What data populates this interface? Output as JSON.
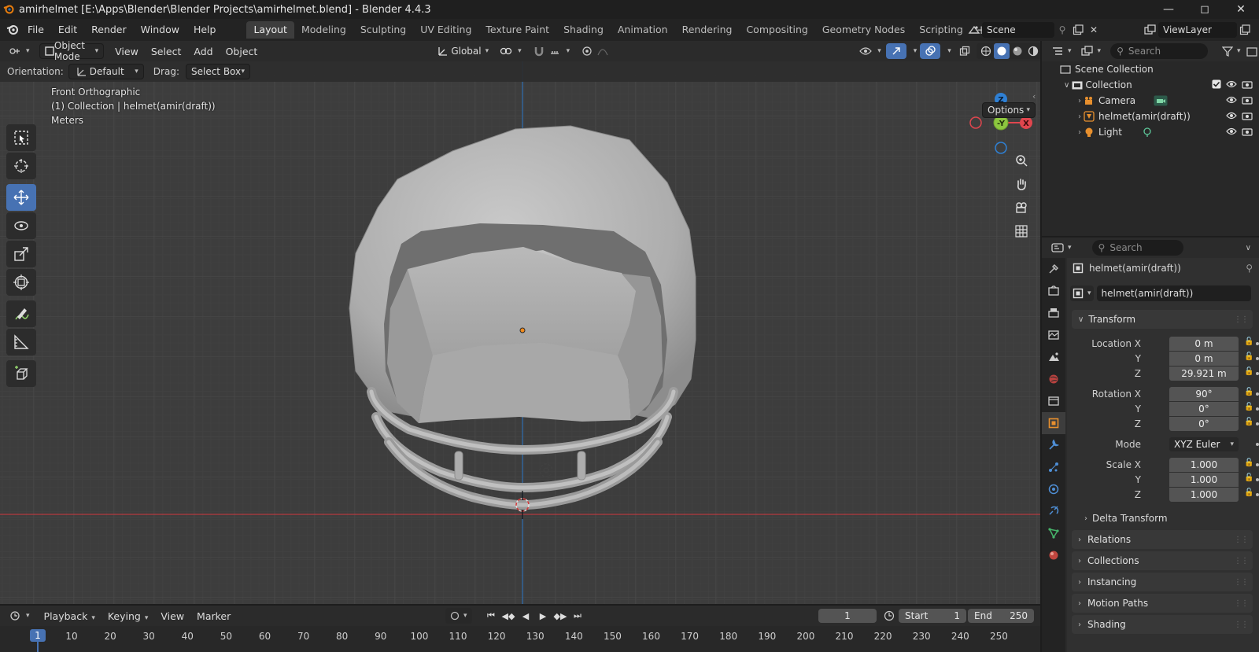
{
  "window": {
    "title": "amirhelmet [E:\\Apps\\Blender\\Blender Projects\\amirhelmet.blend] - Blender 4.4.3",
    "controls": [
      "minimize",
      "maximize",
      "close"
    ]
  },
  "menu": [
    "File",
    "Edit",
    "Render",
    "Window",
    "Help"
  ],
  "workspaces": [
    {
      "label": "Layout",
      "active": true
    },
    {
      "label": "Modeling"
    },
    {
      "label": "Sculpting"
    },
    {
      "label": "UV Editing"
    },
    {
      "label": "Texture Paint"
    },
    {
      "label": "Shading"
    },
    {
      "label": "Animation"
    },
    {
      "label": "Rendering"
    },
    {
      "label": "Compositing"
    },
    {
      "label": "Geometry Nodes"
    },
    {
      "label": "Scripting"
    }
  ],
  "scene": {
    "name": "Scene",
    "view_layer": "ViewLayer"
  },
  "viewport": {
    "mode": "Object Mode",
    "menus": [
      "View",
      "Select",
      "Add",
      "Object"
    ],
    "transform_orientation": "Global",
    "tool_settings": {
      "orientation_label": "Orientation:",
      "orientation_value": "Default",
      "drag_label": "Drag:",
      "drag_value": "Select Box"
    },
    "options_label": "Options",
    "overlay_text": {
      "view_name": "Front Orthographic",
      "collection_line": "(1) Collection | helmet(amir(draft))",
      "units": "Meters"
    },
    "gizmo_axes": {
      "z": "Z",
      "y": "-Y",
      "x": "X"
    }
  },
  "timeline": {
    "menus": [
      "Playback",
      "Keying",
      "View",
      "Marker"
    ],
    "current_frame": "1",
    "start_label": "Start",
    "start_value": "1",
    "end_label": "End",
    "end_value": "250",
    "ruler": [
      "1",
      "10",
      "20",
      "30",
      "40",
      "50",
      "60",
      "70",
      "80",
      "90",
      "100",
      "110",
      "120",
      "130",
      "140",
      "150",
      "160",
      "170",
      "180",
      "190",
      "200",
      "210",
      "220",
      "230",
      "240",
      "250"
    ]
  },
  "outliner": {
    "search_placeholder": "Search",
    "scene_collection": "Scene Collection",
    "collection": "Collection",
    "items": [
      {
        "name": "Camera",
        "type": "camera"
      },
      {
        "name": "helmet(amir(draft))",
        "type": "mesh"
      },
      {
        "name": "Light",
        "type": "light"
      }
    ]
  },
  "properties": {
    "search_placeholder": "Search",
    "object_name": "helmet(amir(draft))",
    "datablock_name": "helmet(amir(draft))",
    "transform": {
      "title": "Transform",
      "location_label": "Location X",
      "location": {
        "x": "0 m",
        "y": "0 m",
        "z": "29.921 m"
      },
      "rotation_label": "Rotation X",
      "rotation": {
        "x": "90°",
        "y": "0°",
        "z": "0°"
      },
      "mode_label": "Mode",
      "mode_value": "XYZ Euler",
      "scale_label": "Scale X",
      "scale": {
        "x": "1.000",
        "y": "1.000",
        "z": "1.000"
      },
      "y_label": "Y",
      "z_label": "Z",
      "delta_transform": "Delta Transform"
    },
    "panels": [
      "Relations",
      "Collections",
      "Instancing",
      "Motion Paths",
      "Shading"
    ]
  },
  "colors": {
    "accent": "#4772b3",
    "viewport_bg": "#3d3d3d",
    "x_axis": "#e0464e",
    "y_axis": "#8cc63f",
    "z_axis": "#2f80d4"
  }
}
